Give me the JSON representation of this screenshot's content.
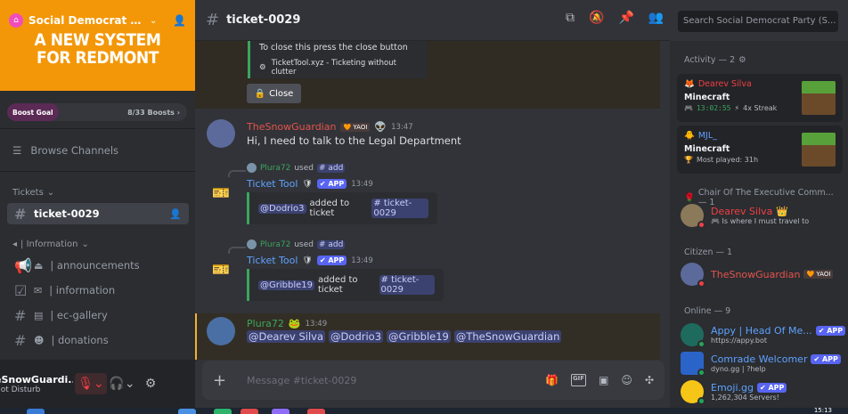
{
  "server": {
    "name": "Social Democrat Party...",
    "banner_line1": "A NEW SYSTEM",
    "banner_line2": "FOR REDMONT",
    "boost_goal_label": "Boost Goal",
    "boost_count": "8/33 Boosts"
  },
  "sidebar": {
    "browse_label": "Browse Channels",
    "categories": [
      {
        "label": "Tickets"
      },
      {
        "label": "| Information"
      }
    ],
    "channels": [
      {
        "name": "ticket-0029",
        "emoji": ""
      },
      {
        "name": "| announcements",
        "emoji": "⏏"
      },
      {
        "name": "| information",
        "emoji": "✉"
      },
      {
        "name": "| ec-gallery",
        "emoji": "▤"
      },
      {
        "name": "| donations",
        "emoji": "☻"
      }
    ]
  },
  "user": {
    "name": "eSnowGuardi...",
    "status": "Not Disturb"
  },
  "header": {
    "channel": "ticket-0029",
    "search_placeholder": "Search Social Democrat Party (S..."
  },
  "messages": {
    "embed_text": "To close this press the close button",
    "embed_footer": "TicketTool.xyz - Ticketing without clutter",
    "close_label": "Close",
    "m1_author": "TheSnowGuardian",
    "m1_tag": "YAOI",
    "m1_time": "13:47",
    "m1_text": "Hi, I need to talk to the Legal Department",
    "reply1_user": "Plura72",
    "reply_used": "used",
    "reply1_cmd": "# add",
    "bot_name": "Ticket Tool",
    "app_badge": "✔ APP",
    "bot1_time": "13:49",
    "added1_mention": "@Dodrio3",
    "added_text": "added to ticket",
    "added_channel": "# ticket-0029",
    "reply2_user": "Plura72",
    "reply2_cmd": "# add",
    "bot2_time": "13:49",
    "added2_mention": "@Gribble19",
    "m3_author": "Plura72",
    "m3_time": "13:49",
    "m3_mentions": [
      "@Dearev Silva",
      "@Dodrio3",
      "@Gribble19",
      "@TheSnowGuardian"
    ]
  },
  "composer": {
    "placeholder": "Message #ticket-0029",
    "gif_label": "GIF"
  },
  "members": {
    "activity_header": "Activity — 2",
    "activity": [
      {
        "name": "Dearev Silva",
        "game": "Minecraft",
        "detail_time": "13:02:55",
        "detail_extra": "4x Streak",
        "name_color": "#f23f43"
      },
      {
        "name": "MJL_",
        "game": "Minecraft",
        "detail_time": "",
        "detail_extra": "Most played: 31h",
        "name_color": "#5fa2ff"
      }
    ],
    "role1_header": "Chair Of The Executive Comm... — 1",
    "role1_member": {
      "name": "Dearev Silva",
      "sub": "Is where I must travel to"
    },
    "citizen_header": "Citizen — 1",
    "citizen_member": {
      "name": "TheSnowGuardian",
      "tag": "YAOI"
    },
    "online_header": "Online — 9",
    "online": [
      {
        "name": "Appy | Head Of Me...",
        "sub": "https://appy.bot"
      },
      {
        "name": "Comrade Welcomer",
        "sub": "dyno.gg | ?help"
      },
      {
        "name": "Emoji.gg",
        "sub": "1,262,304 Servers!"
      }
    ]
  },
  "taskbar": {
    "clock": "15:13"
  },
  "colors": {
    "banner": "#f39708",
    "accent": "#5865f2",
    "online": "#23a55a",
    "dnd": "#f23f43",
    "snow_name": "#e5534b",
    "plura_name": "#3ba55d",
    "bot_name": "#5fa2ff"
  }
}
